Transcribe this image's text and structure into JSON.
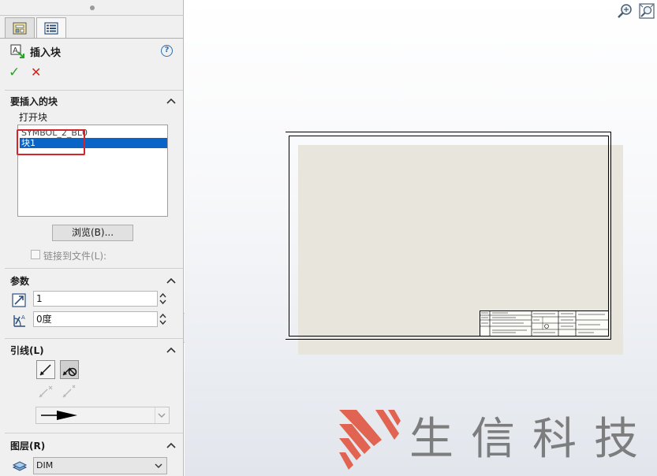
{
  "property_manager": {
    "title": "插入块",
    "help_symbol": "?",
    "ok_symbol": "✓",
    "cancel_symbol": "✕"
  },
  "sections": {
    "blocks_to_insert": {
      "title": "要插入的块",
      "open_blocks_label": "打开块",
      "items": [
        "SYMBOL_2_BL0",
        "块1"
      ],
      "selected_index": 1,
      "browse_label": "浏览(B)...",
      "link_label": "链接到文件(L):",
      "link_checked": false
    },
    "parameters": {
      "title": "参数",
      "scale_value": "1",
      "angle_value": "0度"
    },
    "leader": {
      "title": "引线(L)"
    },
    "layer": {
      "title": "图层(R)",
      "value": "DIM"
    }
  },
  "watermark": {
    "text": "生信科技"
  },
  "colors": {
    "selection": "#0a64c8",
    "highlight_box": "#d4232b",
    "watermark_logo": "#e0543f",
    "sheet_fill": "#e7e5dc"
  }
}
